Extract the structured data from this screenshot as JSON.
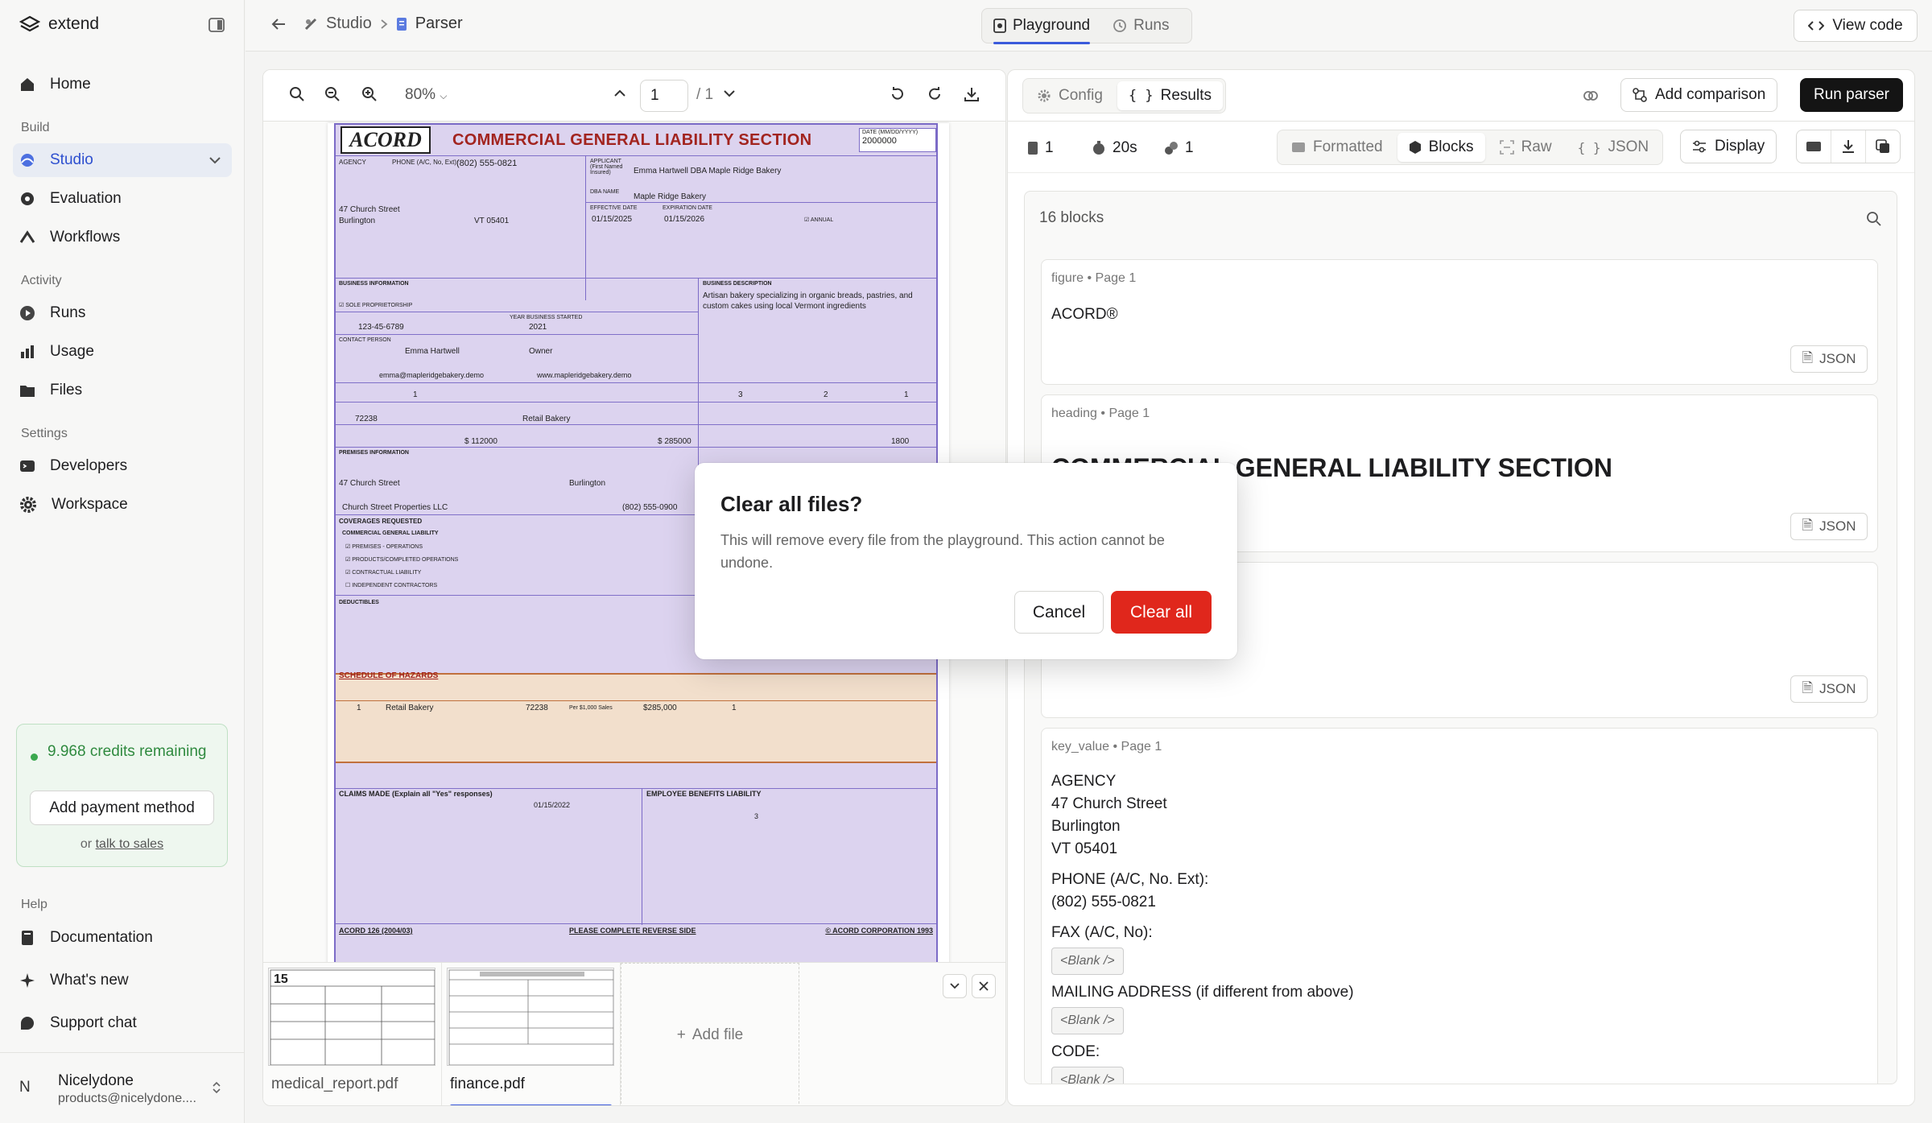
{
  "app": {
    "name": "extend"
  },
  "sidebar": {
    "home": "Home",
    "sections": {
      "build": "Build",
      "activity": "Activity",
      "settings": "Settings",
      "help": "Help"
    },
    "build_items": [
      "Studio",
      "Evaluation",
      "Workflows"
    ],
    "activity_items": [
      "Runs",
      "Usage",
      "Files"
    ],
    "settings_items": [
      "Developers",
      "Workspace"
    ],
    "help_items": [
      "Documentation",
      "What's new",
      "Support chat"
    ],
    "credits": {
      "text": "9.968 credits remaining",
      "button": "Add payment method",
      "or": "or",
      "link": "talk to sales"
    },
    "user": {
      "initial": "N",
      "name": "Nicelydone",
      "email": "products@nicelydone...."
    }
  },
  "topbar": {
    "breadcrumb": [
      "Studio",
      "Parser"
    ],
    "tabs": [
      "Playground",
      "Runs"
    ],
    "view_code": "View code"
  },
  "viewer": {
    "zoom": "80%",
    "page_current": "1",
    "page_total": "/ 1",
    "files": [
      "medical_report.pdf",
      "finance.pdf"
    ],
    "add_file": "Add file",
    "doc": {
      "logo": "ACORD",
      "title": "COMMERCIAL GENERAL LIABILITY SECTION",
      "date_label": "DATE (MM/DD/YYYY)",
      "date": "2000000",
      "agency": "AGENCY",
      "phone_label": "PHONE (A/C, No, Ext):",
      "phone": "(802) 555-0821",
      "applicant_label": "APPLICANT (First Named Insured)",
      "applicant": "Emma Hartwell DBA Maple Ridge Bakery",
      "dba_label": "DBA NAME",
      "dba": "Maple Ridge Bakery",
      "street": "47 Church Street",
      "city": "Burlington",
      "state_zip": "VT   05401",
      "effective_label": "EFFECTIVE DATE",
      "effective": "01/15/2025",
      "expiration_label": "EXPIRATION DATE",
      "expiration": "01/15/2026",
      "annual": "ANNUAL",
      "business_info": "BUSINESS INFORMATION",
      "business_desc_label": "BUSINESS DESCRIPTION",
      "business_desc": "Artisan bakery specializing in organic breads, pastries, and custom cakes using local Vermont ingredients",
      "sole": "SOLE PROPRIETORSHIP",
      "ssn": "123-45-6789",
      "year_label": "YEAR BUSINESS STARTED",
      "year": "2021",
      "contact_label": "CONTACT PERSON",
      "contact": "Emma  Hartwell",
      "contact_title": "Owner",
      "email": "emma@mapleridgebakery.demo",
      "website": "www.mapleridgebakery.demo",
      "owners": "1",
      "ft": "3",
      "pt": "2",
      "seasonal": "1",
      "class_code": "72238",
      "class_desc": "Retail Bakery",
      "payroll": "$ 112000",
      "revenue": "$ 285000",
      "sqft": "1800",
      "premises": "PREMISES INFORMATION",
      "street2": "47 Church Street",
      "city2": "Burlington",
      "landlord": "Church Street Properties LLC",
      "landlord_phone": "(802) 555-0900",
      "coverages": "COVERAGES REQUESTED",
      "cgl": "COMMERCIAL GENERAL LIABILITY",
      "cov_items": [
        "PREMISES - OPERATIONS",
        "PRODUCTS/COMPLETED OPERATIONS",
        "CONTRACTUAL LIABILITY",
        "INDEPENDENT CONTRACTORS"
      ],
      "deductibles": "DEDUCTIBLES",
      "schedule": "SCHEDULE OF HAZARDS",
      "haz_loc": "1",
      "haz_class": "Retail Bakery",
      "haz_code": "72238",
      "haz_basis": "Per $1,000 Sales",
      "haz_exposure": "$285,000",
      "haz_terr": "1",
      "claims": "CLAIMS MADE (Explain all \"Yes\" responses)",
      "retro": "01/15/2022",
      "ebl": "EMPLOYEE BENEFITS LIABILITY",
      "ebl_employees": "3",
      "footer_left": "ACORD 126 (2004/03)",
      "footer_mid": "PLEASE COMPLETE REVERSE SIDE",
      "footer_right": "© ACORD CORPORATION 1993"
    }
  },
  "results": {
    "tabs": [
      "Config",
      "Results"
    ],
    "add_comparison": "Add comparison",
    "run_parser": "Run parser",
    "stats": [
      "1",
      "20s",
      "1"
    ],
    "views": [
      "Formatted",
      "Blocks",
      "Raw",
      "JSON"
    ],
    "display": "Display",
    "block_count": "16 blocks",
    "blocks": [
      {
        "meta": "figure • Page 1",
        "text": "ACORD®"
      },
      {
        "meta": "heading • Page 1",
        "text": "COMMERCIAL GENERAL LIABILITY SECTION"
      },
      {
        "meta": "",
        "text": ""
      },
      {
        "meta": "key_value • Page 1",
        "lines": [
          "AGENCY",
          "47 Church Street",
          "Burlington",
          "VT 05401"
        ],
        "kv": [
          {
            "k": "PHONE (A/C, No. Ext):",
            "v": "(802) 555-0821"
          },
          {
            "k": "FAX (A/C, No):",
            "blank": "<Blank />"
          },
          {
            "k": "MAILING ADDRESS (if different from above)",
            "blank": "<Blank />"
          },
          {
            "k": "CODE:",
            "blank": "<Blank />"
          }
        ]
      }
    ],
    "json_label": "JSON"
  },
  "modal": {
    "title": "Clear all files?",
    "description": "This will remove every file from the playground. This action cannot be undone.",
    "cancel": "Cancel",
    "confirm": "Clear all",
    "confirm_color": "#e0271c"
  }
}
